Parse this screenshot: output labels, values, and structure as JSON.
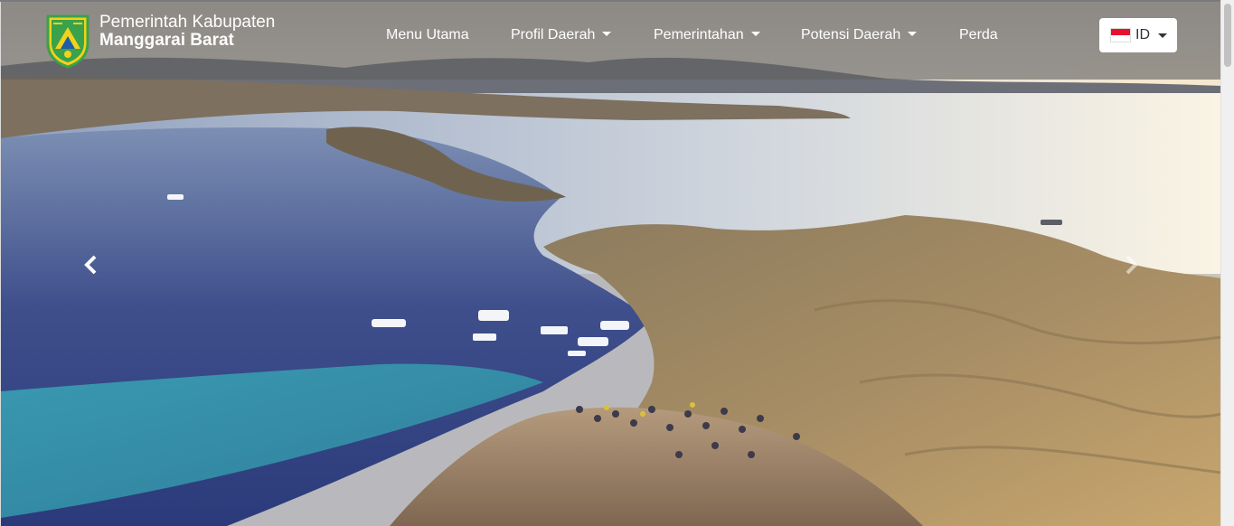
{
  "brand": {
    "line1": "Pemerintah Kabupaten",
    "line2": "Manggarai Barat"
  },
  "nav": {
    "items": [
      {
        "label": "Menu Utama",
        "dropdown": false
      },
      {
        "label": "Profil Daerah",
        "dropdown": true
      },
      {
        "label": "Pemerintahan",
        "dropdown": true
      },
      {
        "label": "Potensi Daerah",
        "dropdown": true
      },
      {
        "label": "Perda",
        "dropdown": false
      }
    ]
  },
  "language": {
    "label": "ID",
    "flag": "indonesia-flag"
  },
  "carousel": {
    "prev_icon": "chevron-left-icon",
    "next_icon": "chevron-right-icon"
  },
  "colors": {
    "navbar_overlay": "#5f5f5f",
    "nav_text": "#ffffff",
    "logo_green": "#3aa24a",
    "logo_yellow": "#f2d21b"
  }
}
